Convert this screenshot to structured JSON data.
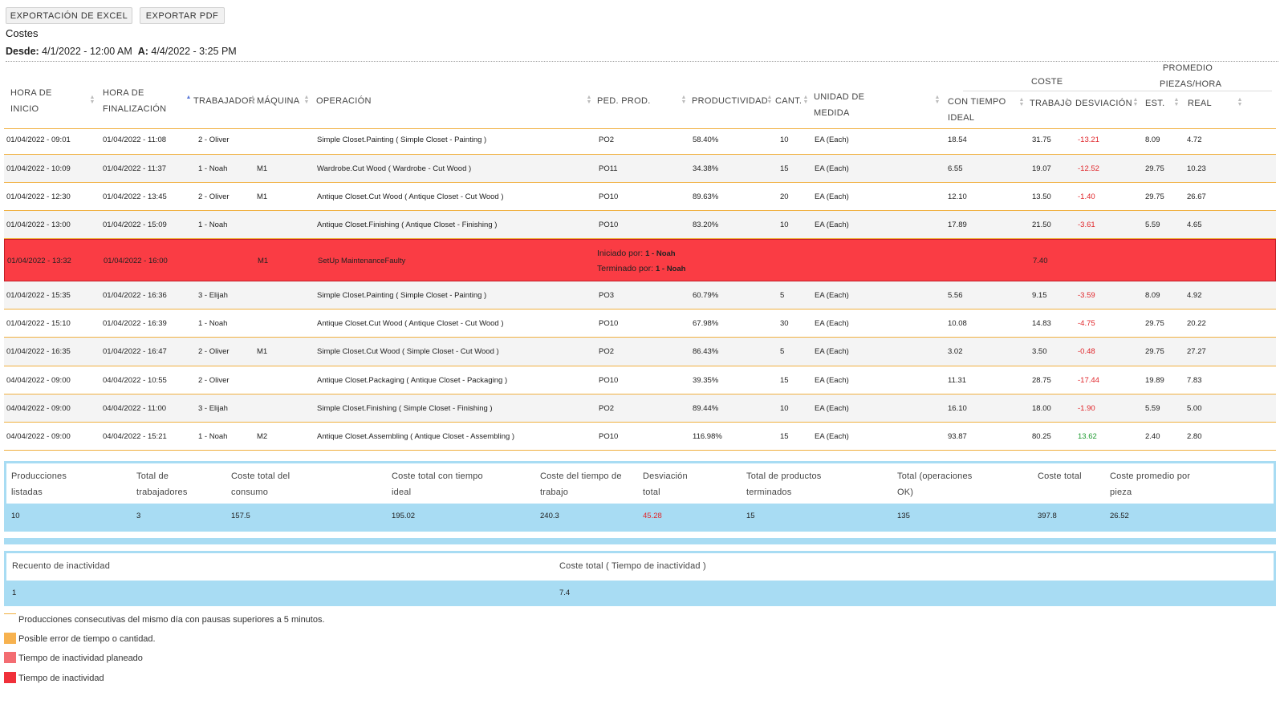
{
  "toolbar": {
    "excel_label": "EXPORTACIÓN DE EXCEL",
    "pdf_label": "EXPORTAR PDF"
  },
  "page": {
    "title": "Costes",
    "from_label": "Desde:",
    "from_value": "4/1/2022 - 12:00 AM",
    "to_label": "A:",
    "to_value": "4/4/2022 - 3:25 PM"
  },
  "columns": {
    "start_l1": "HORA DE",
    "start_l2": "INICIO",
    "end_l1": "HORA DE",
    "end_l2": "FINALIZACIÓN",
    "worker": "TRABAJADOR",
    "machine": "MÁQUINA",
    "operation": "OPERACIÓN",
    "order": "PED. PROD.",
    "productivity": "PRODUCTIVIDAD",
    "qty": "CANT.",
    "unit_l1": "UNIDAD DE",
    "unit_l2": "MEDIDA",
    "cost_group": "COSTE",
    "ideal_l1": "CON TIEMPO",
    "ideal_l2": "IDEAL",
    "work": "TRABAJO",
    "deviation": "DESVIACIÓN",
    "avg_l1": "PROMEDIO",
    "avg_l2": "PIEZAS/HORA",
    "est": "EST.",
    "real": "REAL"
  },
  "rows": [
    {
      "start": "01/04/2022 - 09:01",
      "end": "01/04/2022 - 11:08",
      "worker": "2 - Oliver",
      "machine": "",
      "operation": "Simple Closet.Painting ( Simple Closet - Painting )",
      "order": "PO2",
      "productivity": "58.40%",
      "qty": "10",
      "unit": "EA (Each)",
      "ideal": "18.54",
      "work": "31.75",
      "deviation": "-13.21",
      "est": "8.09",
      "real": "4.72"
    },
    {
      "start": "01/04/2022 - 10:09",
      "end": "01/04/2022 - 11:37",
      "worker": "1 - Noah",
      "machine": "M1",
      "operation": "Wardrobe.Cut Wood ( Wardrobe - Cut Wood )",
      "order": "PO11",
      "productivity": "34.38%",
      "qty": "15",
      "unit": "EA (Each)",
      "ideal": "6.55",
      "work": "19.07",
      "deviation": "-12.52",
      "est": "29.75",
      "real": "10.23"
    },
    {
      "start": "01/04/2022 - 12:30",
      "end": "01/04/2022 - 13:45",
      "worker": "2 - Oliver",
      "machine": "M1",
      "operation": "Antique Closet.Cut Wood ( Antique Closet - Cut Wood )",
      "order": "PO10",
      "productivity": "89.63%",
      "qty": "20",
      "unit": "EA (Each)",
      "ideal": "12.10",
      "work": "13.50",
      "deviation": "-1.40",
      "est": "29.75",
      "real": "26.67"
    },
    {
      "start": "01/04/2022 - 13:00",
      "end": "01/04/2022 - 15:09",
      "worker": "1 - Noah",
      "machine": "",
      "operation": "Antique Closet.Finishing ( Antique Closet - Finishing )",
      "order": "PO10",
      "productivity": "83.20%",
      "qty": "10",
      "unit": "EA (Each)",
      "ideal": "17.89",
      "work": "21.50",
      "deviation": "-3.61",
      "est": "5.59",
      "real": "4.65"
    },
    {
      "start": "01/04/2022 - 13:32",
      "end": "01/04/2022 - 16:00",
      "worker": "",
      "machine": "M1",
      "operation": "SetUp MaintenanceFaulty",
      "order": "",
      "productivity": "",
      "qty": "",
      "unit": "",
      "ideal": "",
      "work": "7.40",
      "deviation": "",
      "est": "",
      "real": "",
      "started_label": "Iniciado por:",
      "started_by": "1 - Noah",
      "finished_label": "Terminado por:",
      "finished_by": "1 - Noah"
    },
    {
      "start": "01/04/2022 - 15:35",
      "end": "01/04/2022 - 16:36",
      "worker": "3 - Elijah",
      "machine": "",
      "operation": "Simple Closet.Painting ( Simple Closet - Painting )",
      "order": "PO3",
      "productivity": "60.79%",
      "qty": "5",
      "unit": "EA (Each)",
      "ideal": "5.56",
      "work": "9.15",
      "deviation": "-3.59",
      "est": "8.09",
      "real": "4.92"
    },
    {
      "start": "01/04/2022 - 15:10",
      "end": "01/04/2022 - 16:39",
      "worker": "1 - Noah",
      "machine": "",
      "operation": "Antique Closet.Cut Wood ( Antique Closet - Cut Wood )",
      "order": "PO10",
      "productivity": "67.98%",
      "qty": "30",
      "unit": "EA (Each)",
      "ideal": "10.08",
      "work": "14.83",
      "deviation": "-4.75",
      "est": "29.75",
      "real": "20.22"
    },
    {
      "start": "01/04/2022 - 16:35",
      "end": "01/04/2022 - 16:47",
      "worker": "2 - Oliver",
      "machine": "M1",
      "operation": "Simple Closet.Cut Wood ( Simple Closet - Cut Wood )",
      "order": "PO2",
      "productivity": "86.43%",
      "qty": "5",
      "unit": "EA (Each)",
      "ideal": "3.02",
      "work": "3.50",
      "deviation": "-0.48",
      "est": "29.75",
      "real": "27.27"
    },
    {
      "start": "04/04/2022 - 09:00",
      "end": "04/04/2022 - 10:55",
      "worker": "2 - Oliver",
      "machine": "",
      "operation": "Antique Closet.Packaging ( Antique Closet - Packaging )",
      "order": "PO10",
      "productivity": "39.35%",
      "qty": "15",
      "unit": "EA (Each)",
      "ideal": "11.31",
      "work": "28.75",
      "deviation": "-17.44",
      "est": "19.89",
      "real": "7.83"
    },
    {
      "start": "04/04/2022 - 09:00",
      "end": "04/04/2022 - 11:00",
      "worker": "3 - Elijah",
      "machine": "",
      "operation": "Simple Closet.Finishing ( Simple Closet - Finishing )",
      "order": "PO2",
      "productivity": "89.44%",
      "qty": "10",
      "unit": "EA (Each)",
      "ideal": "16.10",
      "work": "18.00",
      "deviation": "-1.90",
      "est": "5.59",
      "real": "5.00"
    },
    {
      "start": "04/04/2022 - 09:00",
      "end": "04/04/2022 - 15:21",
      "worker": "1 - Noah",
      "machine": "M2",
      "operation": "Antique Closet.Assembling ( Antique Closet - Assembling )",
      "order": "PO10",
      "productivity": "116.98%",
      "qty": "15",
      "unit": "EA (Each)",
      "ideal": "93.87",
      "work": "80.25",
      "deviation": "13.62",
      "est": "2.40",
      "real": "2.80"
    }
  ],
  "summary": {
    "headers": [
      [
        "Producciones",
        "listadas"
      ],
      [
        "Total de",
        "trabajadores"
      ],
      [
        "Coste total del",
        "consumo"
      ],
      [
        "Coste total con tiempo",
        "ideal"
      ],
      [
        "Coste del tiempo de",
        "trabajo"
      ],
      [
        "Desviación",
        "total"
      ],
      [
        "Total de productos",
        "terminados"
      ],
      [
        "Total (operaciones",
        "OK)"
      ],
      [
        "Coste total",
        ""
      ],
      [
        "Coste promedio por",
        "pieza"
      ]
    ],
    "values": [
      "10",
      "3",
      "157.5",
      "195.02",
      "240.3",
      "45.28",
      "15",
      "135",
      "397.8",
      "26.52"
    ]
  },
  "idle_summary": {
    "headers": [
      "Recuento de inactividad",
      "Coste total ( Tiempo de inactividad )"
    ],
    "values": [
      "1",
      "7.4"
    ]
  },
  "legend": [
    {
      "text": "Producciones consecutivas del mismo día con pausas superiores a 5 minutos.",
      "color": "#f0b040",
      "kind": "line"
    },
    {
      "text": "Posible error de tiempo o cantidad.",
      "color": "#f7b24f",
      "kind": "box"
    },
    {
      "text": "Tiempo de inactividad planeado",
      "color": "#f36d72",
      "kind": "box"
    },
    {
      "text": "Tiempo de inactividad",
      "color": "#f0303a",
      "kind": "box"
    }
  ],
  "colors": {
    "accent_orange": "#f0b040",
    "idle_red": "#fa3c44",
    "summary_blue": "#a8dcf3",
    "negative": "#e0262b",
    "positive": "#1d9a2f"
  }
}
